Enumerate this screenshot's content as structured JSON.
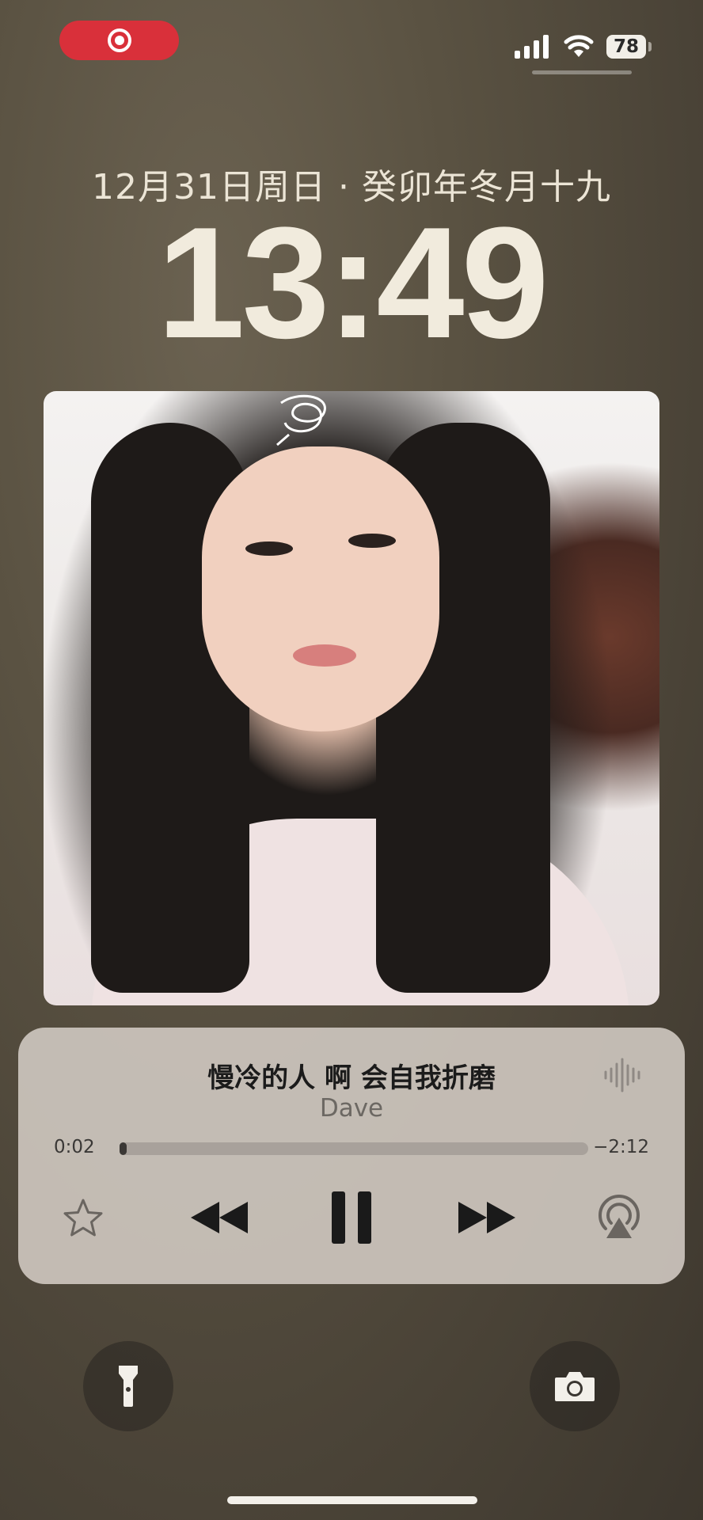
{
  "status_bar": {
    "recording_color": "#d9303a",
    "signal_icon": "cellular-signal-icon",
    "wifi_icon": "wifi-icon",
    "battery_level": "78"
  },
  "lock_screen": {
    "date": "12月31日周日 · 癸卯年冬月十九",
    "time": "13:49"
  },
  "now_playing": {
    "title": "慢冷的人 啊 会自我折磨",
    "artist": "Dave",
    "elapsed": "0:02",
    "remaining": "−2:12",
    "progress": 0.015,
    "controls": [
      "star-icon",
      "rewind-icon",
      "pause-icon",
      "fast-forward-icon",
      "airplay-icon"
    ]
  },
  "quick_actions": {
    "left": "flashlight-icon",
    "right": "camera-icon"
  }
}
